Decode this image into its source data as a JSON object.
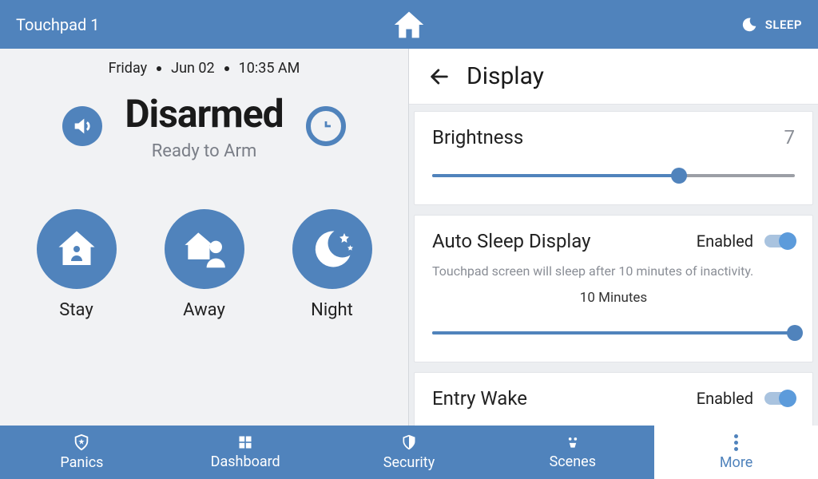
{
  "topbar": {
    "title": "Touchpad 1",
    "sleep_label": "SLEEP"
  },
  "status": {
    "day": "Friday",
    "date": "Jun 02",
    "time": "10:35 AM",
    "state": "Disarmed",
    "sub": "Ready to Arm"
  },
  "modes": {
    "stay": "Stay",
    "away": "Away",
    "night": "Night"
  },
  "settings": {
    "page_title": "Display",
    "brightness": {
      "label": "Brightness",
      "value": "7",
      "pct": 68
    },
    "autosleep": {
      "label": "Auto Sleep Display",
      "state": "Enabled",
      "desc": "Touchpad screen will sleep after 10 minutes of inactivity.",
      "value": "10 Minutes",
      "pct": 100
    },
    "entrywake": {
      "label": "Entry Wake",
      "state": "Enabled"
    }
  },
  "nav": {
    "panics": "Panics",
    "dashboard": "Dashboard",
    "security": "Security",
    "scenes": "Scenes",
    "more": "More"
  }
}
